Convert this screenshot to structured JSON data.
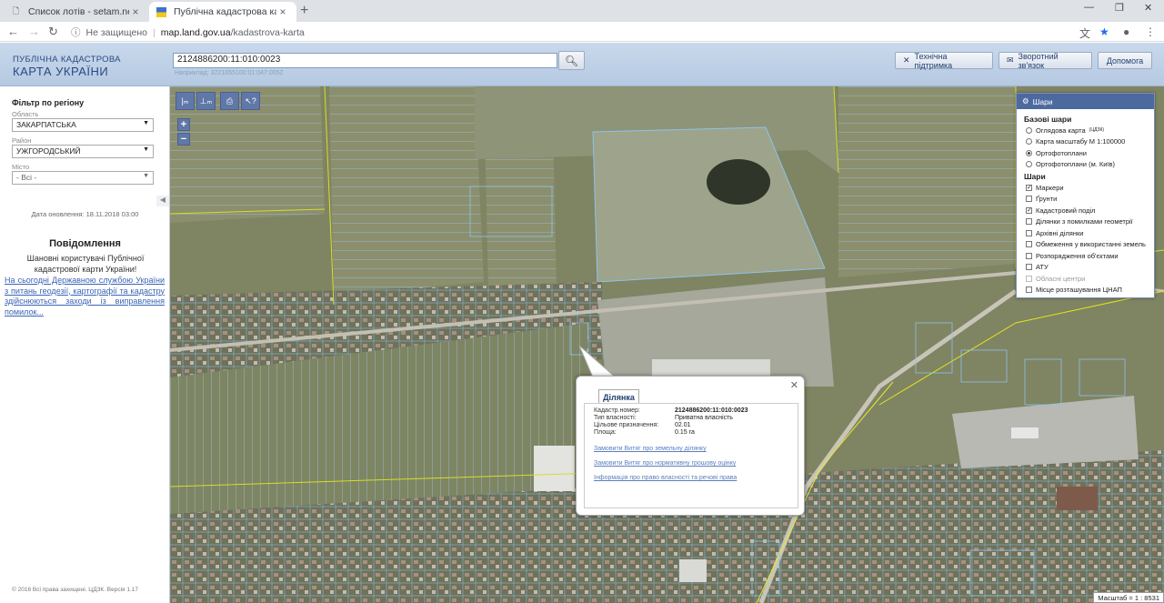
{
  "browser": {
    "tabs": [
      {
        "title": "Список лотів - setam.net.ua",
        "active": false
      },
      {
        "title": "Публічна кадастрова карта Укра",
        "active": true
      }
    ],
    "not_secure": "Не защищено",
    "url_domain": "map.land.gov.ua",
    "url_path": "/kadastrova-karta"
  },
  "header": {
    "logo_line1": "ПУБЛІЧНА КАДАСТРОВА",
    "logo_line2": "КАРТА УКРАЇНИ",
    "search_value": "2124886200:11:010:0023",
    "search_hint": "Наприклад: 3221655100:01:047:0052",
    "buttons": {
      "support": "Технічна підтримка",
      "feedback": "Зворотний зв'язок",
      "help": "Допомога"
    }
  },
  "sidebar": {
    "filter_title": "Фільтр по регіону",
    "region_label": "Область",
    "region_value": "ЗАКАРПАТСЬКА",
    "district_label": "Район",
    "district_value": "УЖГОРОДСЬКИЙ",
    "city_label": "Місто",
    "city_value": "- Всі -",
    "updated": "Дата оновлення: 18.11.2018 03:00",
    "message_title": "Повідомлення",
    "message_body": "Шановні користувачі Публічної кадастрової карти України!",
    "message_link": "На сьогодні Державною службою України з питань геодезії, картографії та кадастру здійснюються заходи із виправлення помилок...",
    "copyright": "© 2016 Всі права захищені. ЦДЗК. Версія 1.17"
  },
  "layers": {
    "title": "Шари",
    "base_title": "Базові шари",
    "base": [
      {
        "label": "Оглядова карта",
        "sup": "(ЦДЗК)",
        "selected": false
      },
      {
        "label": "Карта масштабу М 1:100000",
        "selected": false
      },
      {
        "label": "Ортофотоплани",
        "selected": true
      },
      {
        "label": "Ортофотоплани (м. Київ)",
        "selected": false
      }
    ],
    "overlay_title": "Шари",
    "overlays": [
      {
        "label": "Маркери",
        "checked": true,
        "disabled": false
      },
      {
        "label": "Ґрунти",
        "checked": false,
        "disabled": false
      },
      {
        "label": "Кадастровий поділ",
        "checked": true,
        "disabled": false
      },
      {
        "label": "Ділянки з помилками геометрії",
        "checked": false,
        "disabled": false
      },
      {
        "label": "Архівні ділянки",
        "checked": false,
        "disabled": false
      },
      {
        "label": "Обмеження у використанні земель",
        "checked": false,
        "disabled": false
      },
      {
        "label": "Розпорядження об'єктами",
        "checked": false,
        "disabled": false
      },
      {
        "label": "АТУ",
        "checked": false,
        "disabled": false
      },
      {
        "label": "Обласні центри",
        "checked": false,
        "disabled": true
      },
      {
        "label": "Місце розташування ЦНАП",
        "checked": false,
        "disabled": false
      }
    ]
  },
  "popup": {
    "tab": "Ділянка",
    "rows": [
      {
        "key": "Кадастр.номер:",
        "value": "2124886200:11:010:0023"
      },
      {
        "key": "Тип власності:",
        "value": "Приватна власність"
      },
      {
        "key": "Цільове призначення:",
        "value": "02.01"
      },
      {
        "key": "Площа:",
        "value": "0.15 га"
      }
    ],
    "links": [
      "Замовити Витяг про земельну ділянку",
      "Замовити Витяг про нормативну грошову оцінку",
      "Інформація про право власності та речові права"
    ]
  },
  "map": {
    "scale": "Масштаб = 1 : 8531",
    "zoom_in": "+",
    "zoom_out": "−"
  }
}
